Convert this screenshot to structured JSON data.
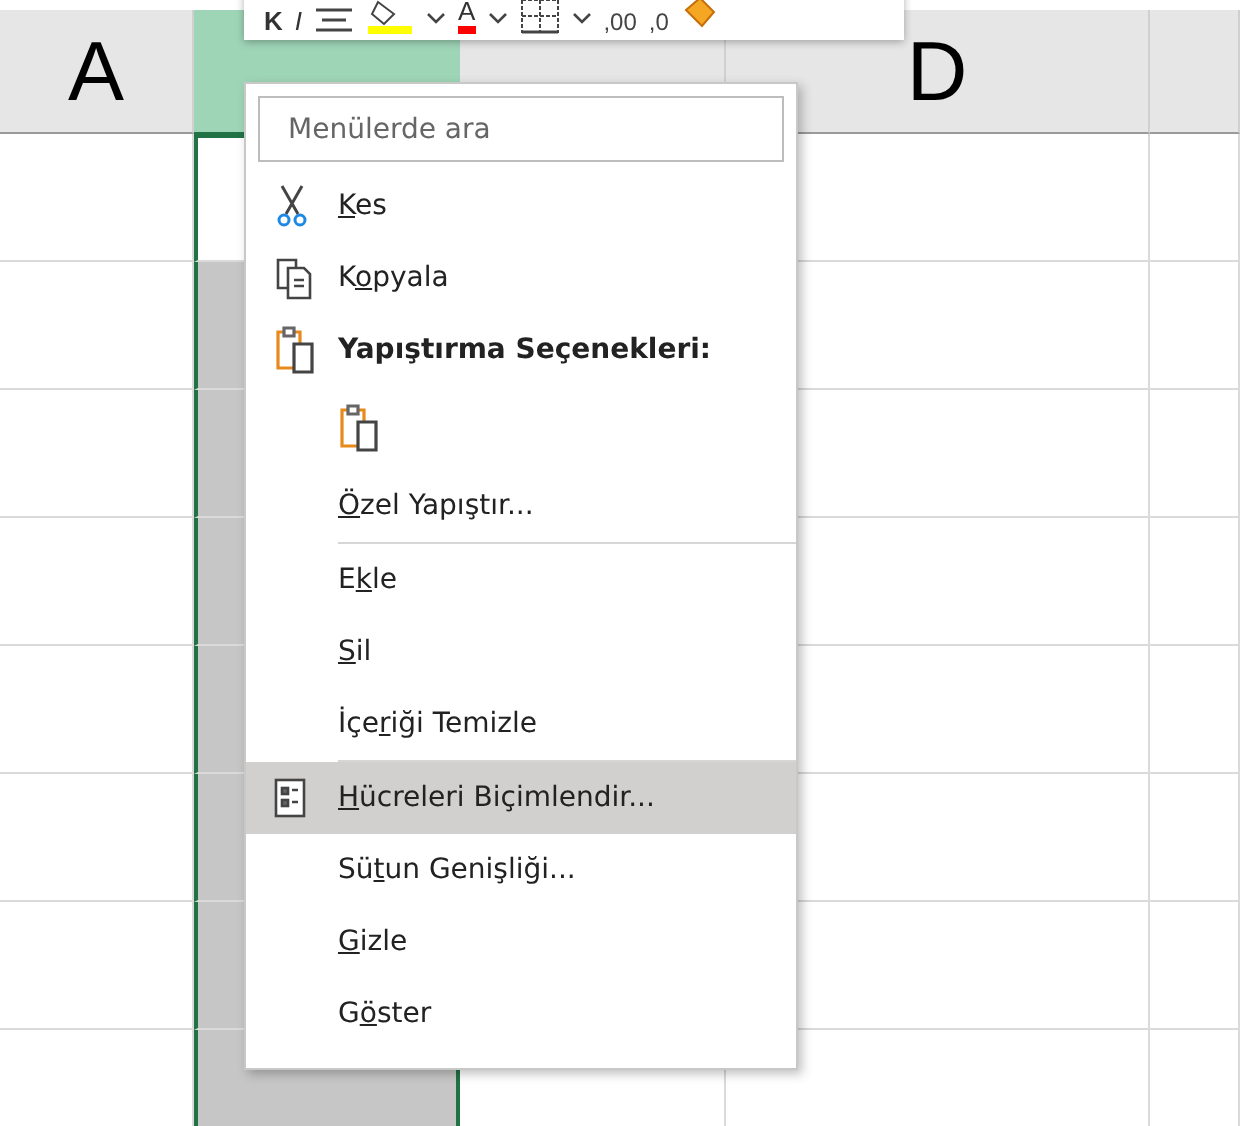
{
  "sheet": {
    "columns": [
      {
        "label": "A",
        "selected": false
      },
      {
        "selected": true
      },
      {
        "selected": false
      },
      {
        "label": "D",
        "selected": false
      },
      {
        "selected": false
      }
    ]
  },
  "mini_toolbar": [
    {
      "kind": "bold",
      "text": "K"
    },
    {
      "kind": "italic",
      "text": "I"
    },
    {
      "kind": "align"
    },
    {
      "kind": "fill",
      "color": "#ffff00"
    },
    {
      "kind": "chevron"
    },
    {
      "kind": "fontcolor",
      "text": "A",
      "color": "#ff0000"
    },
    {
      "kind": "chevron"
    },
    {
      "kind": "border"
    },
    {
      "kind": "chevron"
    },
    {
      "kind": "decimal",
      "text": ",00"
    },
    {
      "kind": "decimal",
      "text": ",0"
    },
    {
      "kind": "painter"
    }
  ],
  "context_menu": {
    "search": {
      "placeholder": "Menülerde ara"
    },
    "items": [
      {
        "kind": "cut",
        "label": {
          "key": "K",
          "after": "es"
        },
        "selected": false
      },
      {
        "kind": "copy",
        "label": {
          "before": "K",
          "key": "o",
          "after": "pyala"
        },
        "selected": false
      },
      {
        "kind": "heading",
        "label": {
          "before": "Yapıştırma Seçenekleri:"
        }
      },
      {
        "kind": "paste"
      },
      {
        "kind": "plain",
        "label": {
          "key": "Ö",
          "after": "zel Yapıştır..."
        },
        "selected": false
      },
      {
        "kind": "separator"
      },
      {
        "kind": "plain",
        "label": {
          "before": "E",
          "key": "k",
          "after": "le"
        },
        "selected": false
      },
      {
        "kind": "plain",
        "label": {
          "key": "S",
          "after": "il"
        },
        "selected": false
      },
      {
        "kind": "plain",
        "label": {
          "before": "İçe",
          "key": "r",
          "after": "iği Temizle"
        },
        "selected": false
      },
      {
        "kind": "separator"
      },
      {
        "kind": "format",
        "label": {
          "key": "H",
          "after": "ücreleri Biçimlendir..."
        },
        "selected": true
      },
      {
        "kind": "plain",
        "label": {
          "before": "Sü",
          "key": "t",
          "after": "un Genişliği..."
        },
        "selected": false
      },
      {
        "kind": "plain",
        "label": {
          "key": "G",
          "after": "izle"
        },
        "selected": false
      },
      {
        "kind": "plain",
        "label": {
          "before": "G",
          "key": "ö",
          "after": "ster"
        },
        "selected": false
      }
    ]
  }
}
